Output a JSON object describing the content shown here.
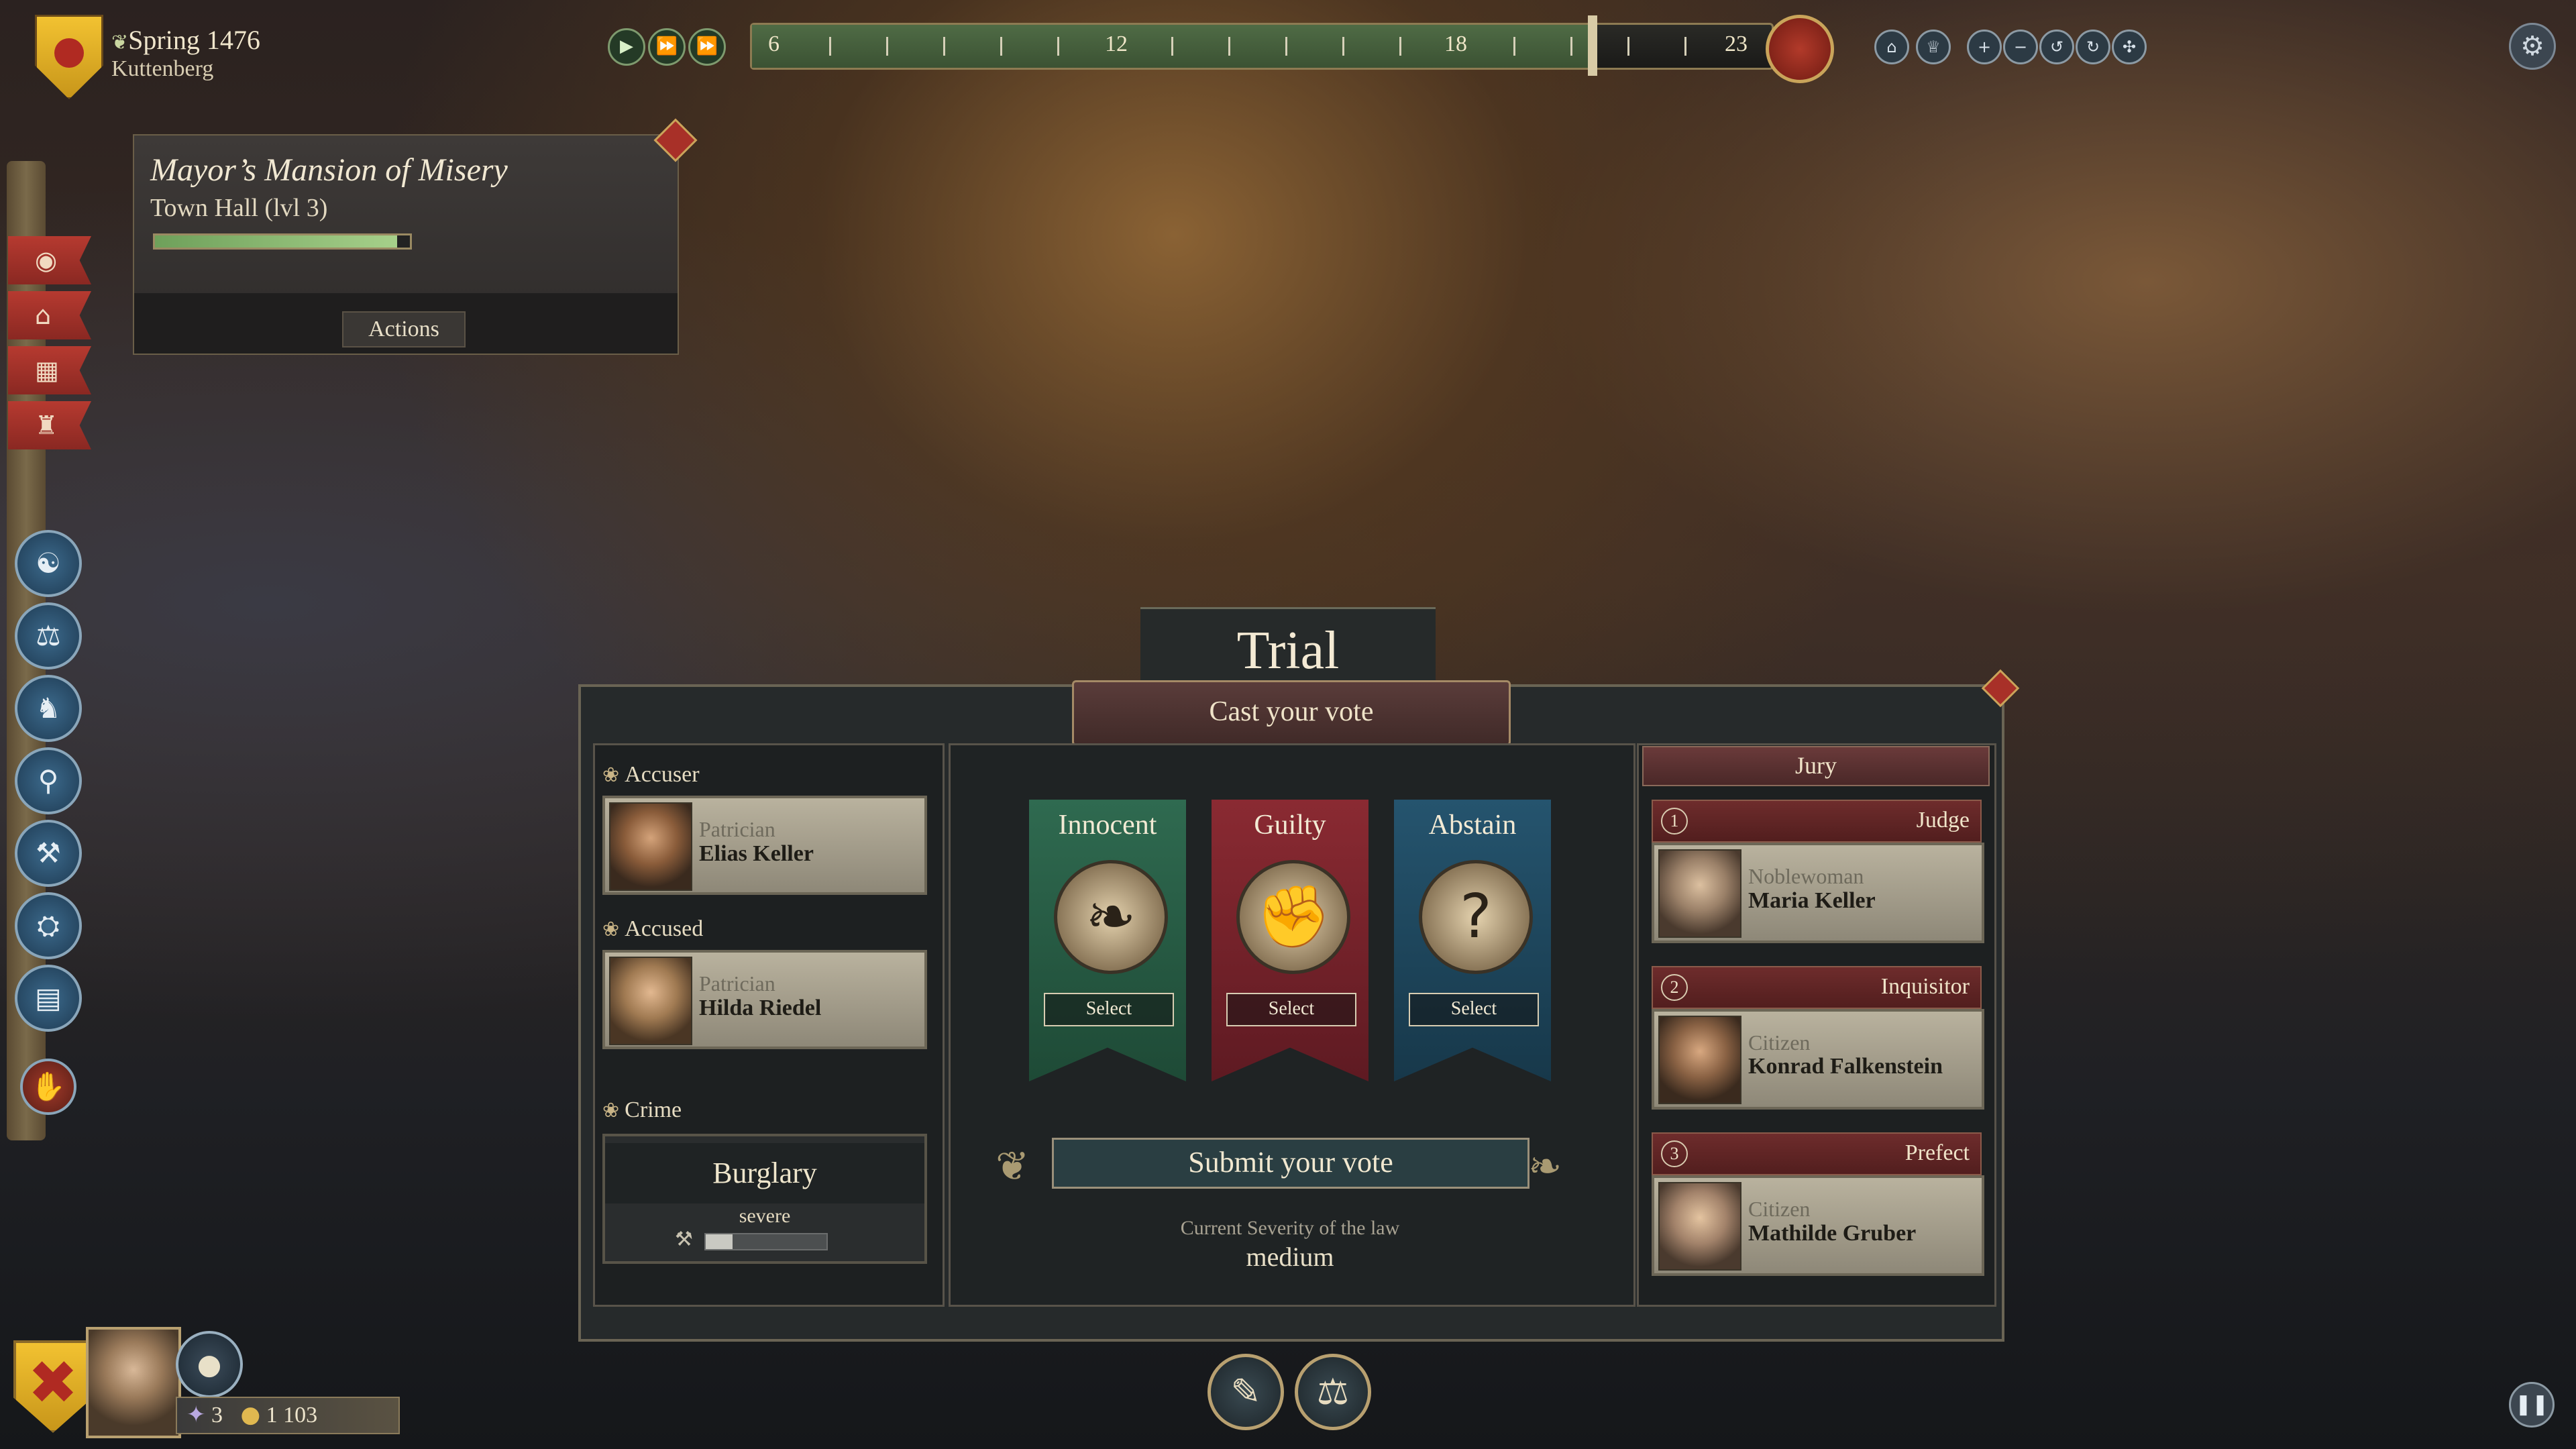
{
  "header": {
    "season": "Spring 1476",
    "town": "Kuttenberg"
  },
  "timeline": {
    "labels": [
      "6",
      "12",
      "18",
      "23"
    ],
    "progress": 0.82
  },
  "building": {
    "name": "Mayor’s Mansion of Misery",
    "type": "Town Hall (lvl 3)",
    "progress": 0.95,
    "actions_label": "Actions"
  },
  "trial": {
    "title": "Trial",
    "cast_vote_label": "Cast your vote",
    "accuser": {
      "label": "Accuser",
      "role": "Patrician",
      "name": "Elias Keller"
    },
    "accused": {
      "label": "Accused",
      "role": "Patrician",
      "name": "Hilda Riedel"
    },
    "crime": {
      "label": "Crime",
      "name": "Burglary",
      "severity": "severe"
    },
    "options": [
      {
        "title": "Innocent",
        "select_label": "Select",
        "color": "#2f6a50",
        "icon": "dove-icon"
      },
      {
        "title": "Guilty",
        "select_label": "Select",
        "color": "#8a2a32",
        "icon": "fist-icon"
      },
      {
        "title": "Abstain",
        "select_label": "Select",
        "color": "#25546e",
        "icon": "question-icon"
      }
    ],
    "submit_label": "Submit your vote",
    "severity_label": "Current Severity of the law",
    "severity_value": "medium",
    "jury": {
      "title": "Jury",
      "members": [
        {
          "num": "1",
          "role": "Judge",
          "rank": "Noblewoman",
          "name": "Maria Keller"
        },
        {
          "num": "2",
          "role": "Inquisitor",
          "rank": "Citizen",
          "name": "Konrad Falkenstein"
        },
        {
          "num": "3",
          "role": "Prefect",
          "rank": "Citizen",
          "name": "Mathilde Gruber"
        }
      ]
    }
  },
  "resources": {
    "influence": "3",
    "gold": "1 103"
  },
  "colors": {
    "innocent": "#2f6a50",
    "guilty": "#8a2a32",
    "abstain": "#25546e",
    "jury_header": "#6a3a3a"
  }
}
